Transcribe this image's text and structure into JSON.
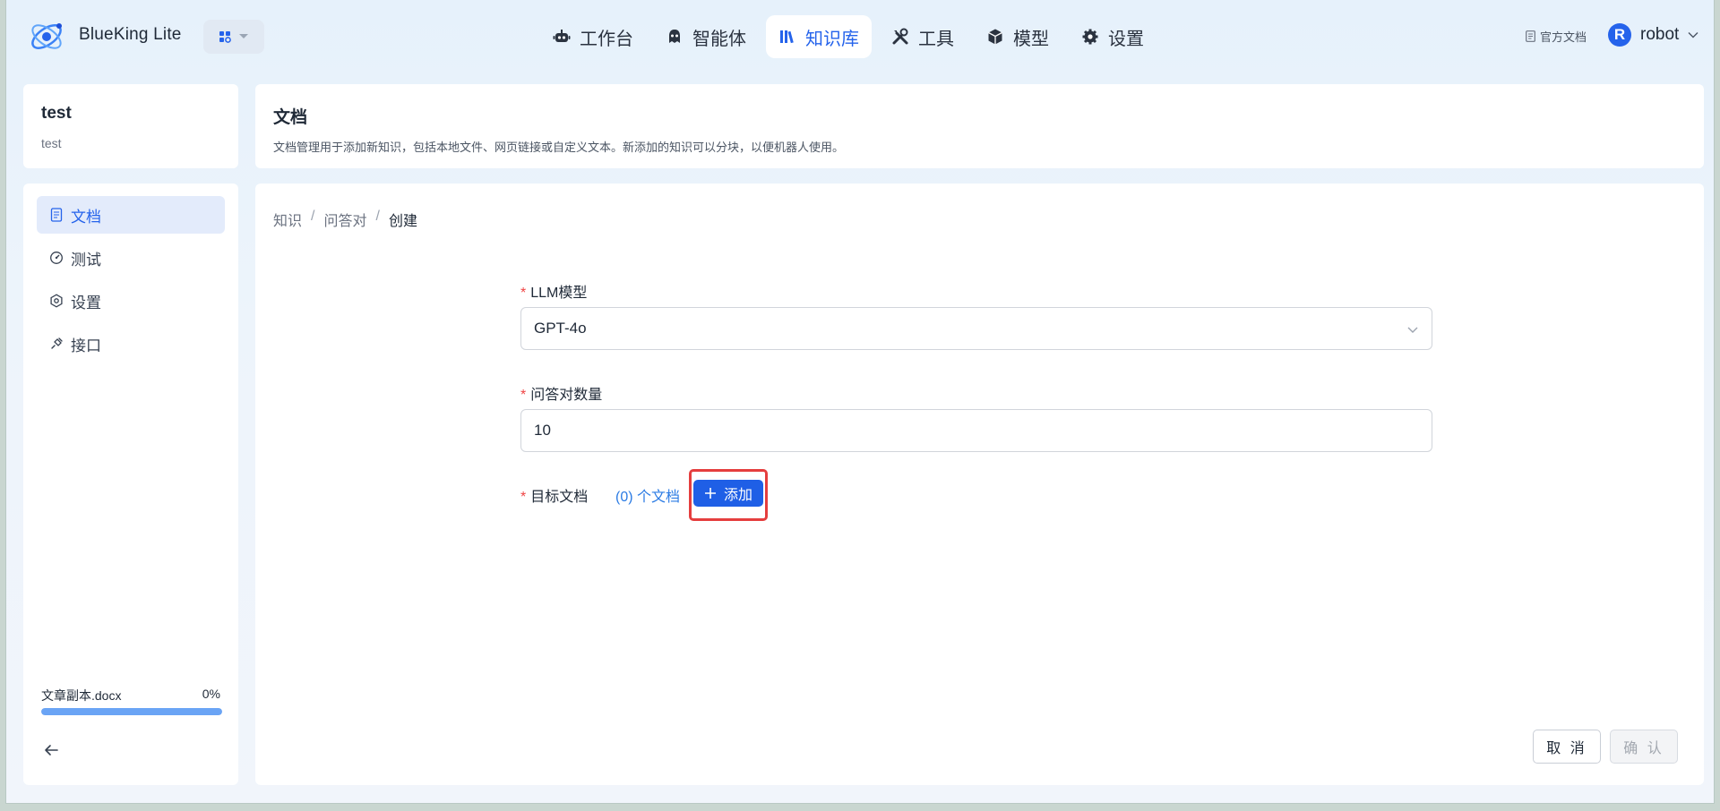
{
  "header": {
    "brand": "BlueKing Lite",
    "nav": [
      {
        "label": "工作台",
        "icon": "robot-icon"
      },
      {
        "label": "智能体",
        "icon": "agent-icon"
      },
      {
        "label": "知识库",
        "icon": "books-icon",
        "active": true
      },
      {
        "label": "工具",
        "icon": "tools-icon"
      },
      {
        "label": "模型",
        "icon": "cube-icon"
      },
      {
        "label": "设置",
        "icon": "gear-icon"
      }
    ],
    "doc_link": "官方文档",
    "avatar_letter": "R",
    "user": "robot"
  },
  "knowledge_base": {
    "title": "test",
    "description": "test"
  },
  "sidebar": {
    "items": [
      {
        "label": "文档",
        "icon": "document-icon",
        "active": true
      },
      {
        "label": "测试",
        "icon": "gauge-icon"
      },
      {
        "label": "设置",
        "icon": "settings-icon"
      },
      {
        "label": "接口",
        "icon": "link-icon"
      }
    ],
    "upload": {
      "filename": "文章副本.docx",
      "percent_label": "0%",
      "progress": 1.0
    }
  },
  "page": {
    "title": "文档",
    "description": "文档管理用于添加新知识，包括本地文件、网页链接或自定义文本。新添加的知识可以分块，以便机器人使用。"
  },
  "breadcrumb": [
    "知识",
    "问答对",
    "创建"
  ],
  "form": {
    "llm_label": "LLM模型",
    "llm_value": "GPT-4o",
    "qa_count_label": "问答对数量",
    "qa_count_value": "10",
    "target_label": "目标文档",
    "doc_count": "(0) 个文档",
    "add_label": "添加"
  },
  "actions": {
    "cancel": "取 消",
    "confirm": "确 认"
  },
  "colors": {
    "accent": "#2563eb",
    "required": "#ef4444",
    "highlight": "#e53e3e"
  }
}
